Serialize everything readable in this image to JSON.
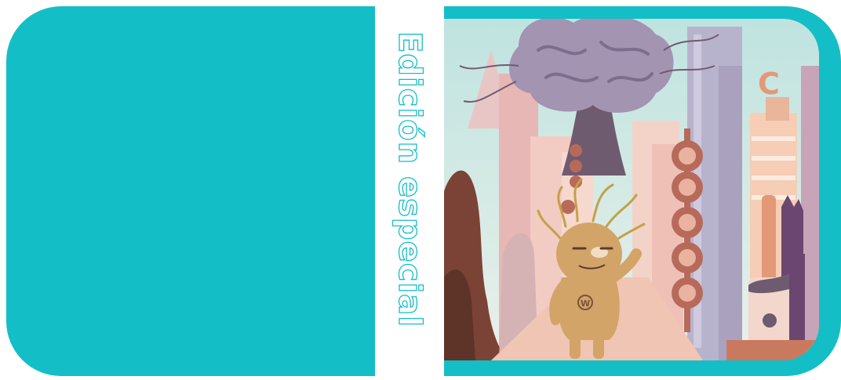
{
  "cover": {
    "spine_text": "Edición especial",
    "tower_letter": "C",
    "badge_letter": "W"
  },
  "colors": {
    "teal": "#14bec7",
    "sky": "#cfe9e6",
    "brain": "#a394b1",
    "stem": "#6f5b70",
    "creature": "#d3a468",
    "beads": "#b86a5a"
  }
}
